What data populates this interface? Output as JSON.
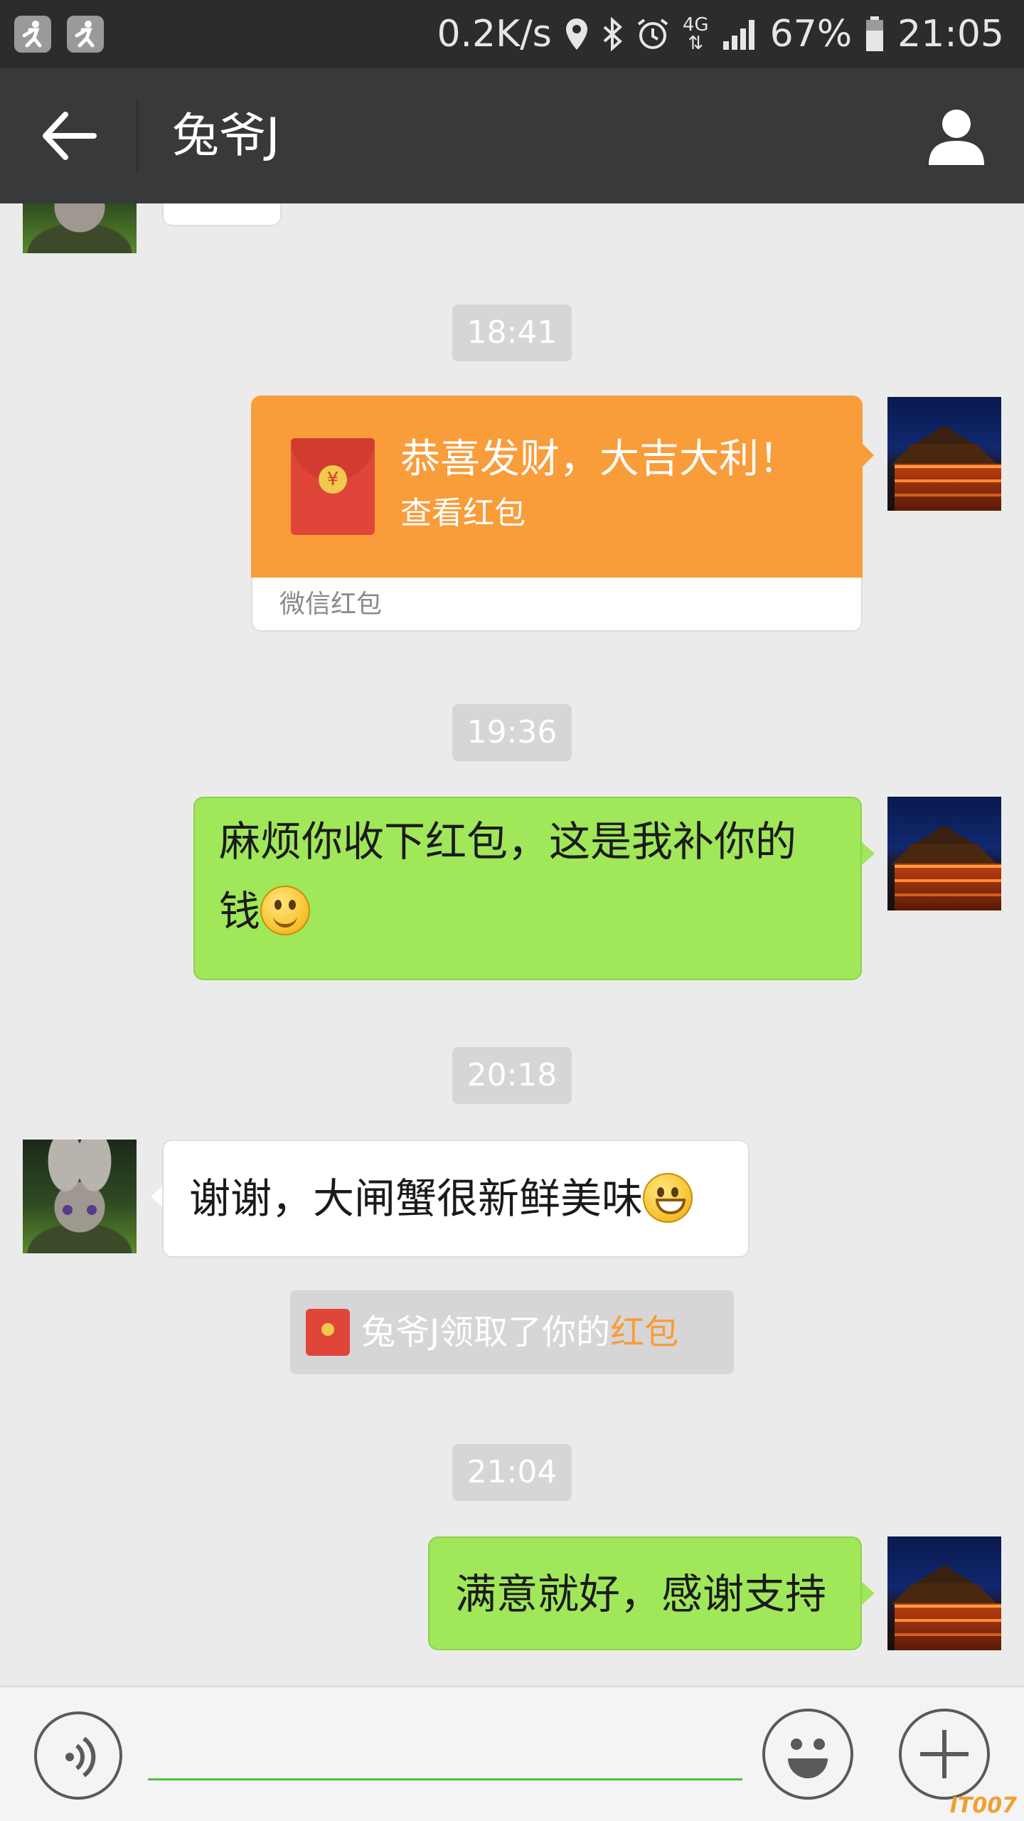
{
  "status_bar": {
    "network_speed": "0.2K/s",
    "network_type": "4G",
    "battery": "67%",
    "time": "21:05",
    "left_icons": [
      "running-app-icon",
      "running-app-icon"
    ],
    "right_icons": [
      "location-icon",
      "bluetooth-icon",
      "alarm-icon",
      "4g-icon",
      "signal-icon",
      "battery-icon"
    ]
  },
  "header": {
    "title": "兔爷J",
    "back_icon": "back-arrow-icon",
    "profile_icon": "person-icon"
  },
  "messages": [
    {
      "type": "timestamp",
      "text": "18:41"
    },
    {
      "type": "red_packet",
      "side": "right",
      "title": "恭喜发财，大吉大利！",
      "subtitle": "查看红包",
      "footer": "微信红包",
      "envelope_symbol": "¥"
    },
    {
      "type": "timestamp",
      "text": "19:36"
    },
    {
      "type": "text",
      "side": "right",
      "line1": "麻烦你收下红包，这是我补你的",
      "line2": "钱",
      "emoji": "smile-emoji"
    },
    {
      "type": "timestamp",
      "text": "20:18"
    },
    {
      "type": "text",
      "side": "left",
      "text": "谢谢，大闸蟹很新鲜美味",
      "emoji": "grin-emoji"
    },
    {
      "type": "system",
      "prefix": "兔爷J领取了你的",
      "highlight": "红包"
    },
    {
      "type": "timestamp",
      "text": "21:04"
    },
    {
      "type": "text",
      "side": "right",
      "text": "满意就好，感谢支持"
    }
  ],
  "input_bar": {
    "value": "",
    "voice_icon": "voice-icon",
    "emoji_icon": "emoji-icon",
    "plus_icon": "plus-icon"
  },
  "watermark": "IT007",
  "colors": {
    "status_bar": "#2a2c2e",
    "title_bar": "#37393b",
    "chat_background": "#ebebeb",
    "sent_bubble": "#a0e75a",
    "red_packet": "#f99c3a",
    "input_underline": "#4cc13a"
  }
}
